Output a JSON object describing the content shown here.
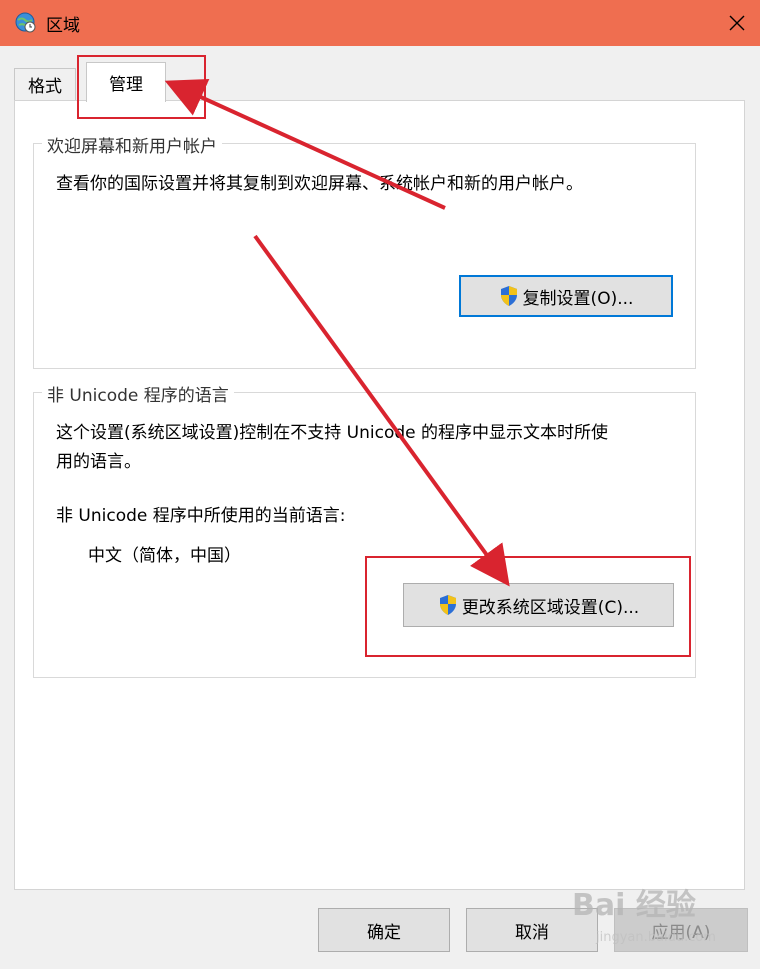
{
  "window": {
    "title": "区域",
    "close_icon": "close-icon"
  },
  "tabs": [
    {
      "label": "格式",
      "selected": false
    },
    {
      "label": "管理",
      "selected": true
    }
  ],
  "welcome_group": {
    "legend": "欢迎屏幕和新用户帐户",
    "description": "查看你的国际设置并将其复制到欢迎屏幕、系统帐户和新的用户帐户。",
    "copy_button": "复制设置(O)..."
  },
  "unicode_group": {
    "legend": "非 Unicode 程序的语言",
    "description_line1": "这个设置(系统区域设置)控制在不支持 Unicode 的程序中显示文本时所使",
    "description_line2": "用的语言。",
    "current_label": "非 Unicode 程序中所使用的当前语言:",
    "current_value": "中文（简体，中国）",
    "change_button": "更改系统区域设置(C)..."
  },
  "footer": {
    "ok": "确定",
    "cancel": "取消",
    "apply": "应用(A)"
  },
  "watermark": {
    "brand": "Bai 经验",
    "url": "jingyan.baidu.com"
  },
  "colors": {
    "titlebar": "#ef6e50",
    "annotation_red": "#d9242f",
    "focus_blue": "#0078d7"
  }
}
